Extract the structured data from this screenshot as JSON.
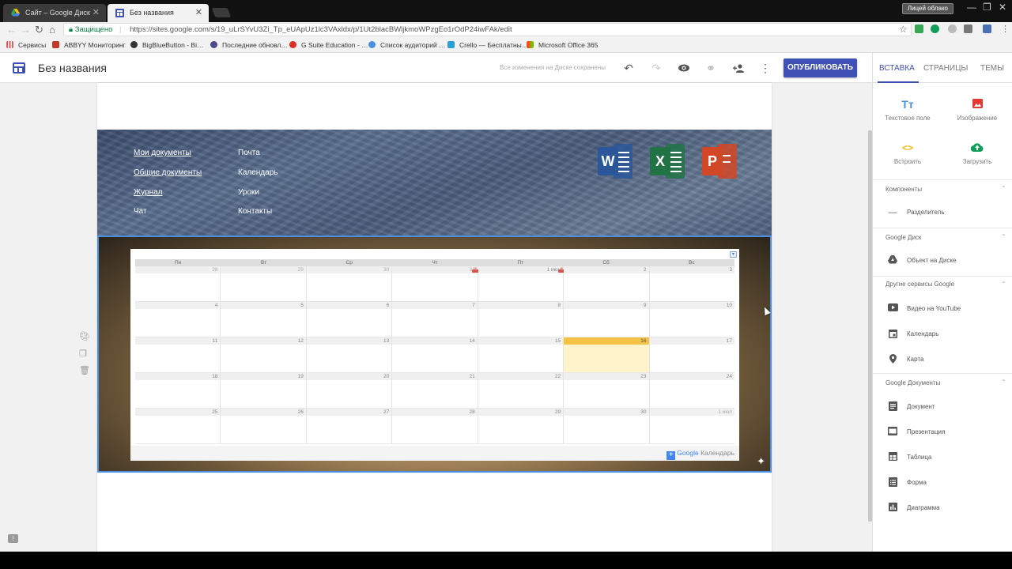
{
  "browser": {
    "tabs": [
      {
        "title": "Сайт – Google Диск",
        "active": false
      },
      {
        "title": "Без названия",
        "active": true
      }
    ],
    "profile": "Лицей облако",
    "secure_label": "Защищено",
    "url": "https://sites.google.com/s/19_uLrSYvU3Zi_Tp_eUApUz1lc3VAxldx/p/1Ut2blacBWljkmoWPzgEo1rOdP24iwFAk/edit",
    "bookmarks": [
      {
        "label": "Сервисы",
        "color": "#e06060"
      },
      {
        "label": "ABBYY Мониторинг",
        "color": "#c0392b"
      },
      {
        "label": "BigBlueButton - Bi…",
        "color": "#333333"
      },
      {
        "label": "Последние обновл…",
        "color": "#4a4a8a"
      },
      {
        "label": "G Suite Education - …",
        "color": "#d93025"
      },
      {
        "label": "Список аудиторий …",
        "color": "#4a90e2"
      },
      {
        "label": "Crello — Бесплатны…",
        "color": "#2a9fd6"
      },
      {
        "label": "Microsoft Office 365",
        "color": "#f25022"
      }
    ]
  },
  "editor": {
    "title": "Без названия",
    "saved_status": "Все изменения на Диске сохранены",
    "publish_label": "ОПУБЛИКОВАТЬ"
  },
  "header_nav": {
    "col1": [
      "Мои документы",
      "Общие документы",
      "Журнал",
      "Чат"
    ],
    "col2": [
      "Почта",
      "Календарь",
      "Уроки",
      "Контакты"
    ],
    "office_letters": [
      "W",
      "X",
      "P"
    ]
  },
  "calendar": {
    "weekdays": [
      "Пн",
      "Вт",
      "Ср",
      "Чт",
      "Пт",
      "Сб",
      "Вс"
    ],
    "weeks": [
      [
        "28",
        "29",
        "30",
        "31",
        "1 июн",
        "2",
        "3"
      ],
      [
        "4",
        "5",
        "6",
        "7",
        "8",
        "9",
        "10"
      ],
      [
        "11",
        "12",
        "13",
        "14",
        "15",
        "16",
        "17"
      ],
      [
        "18",
        "19",
        "20",
        "21",
        "22",
        "23",
        "24"
      ],
      [
        "25",
        "26",
        "27",
        "28",
        "29",
        "30",
        "1 июл"
      ]
    ],
    "today": "16",
    "brand_google": "Google",
    "brand_calendar": "Календарь"
  },
  "panel": {
    "tabs": [
      "ВСТАВКА",
      "СТРАНИЦЫ",
      "ТЕМЫ"
    ],
    "insert_items": [
      {
        "label": "Текстовое поле",
        "icon": "text-box-icon"
      },
      {
        "label": "Изображение",
        "icon": "image-icon"
      },
      {
        "label": "Встроить",
        "icon": "embed-icon"
      },
      {
        "label": "Загрузить",
        "icon": "upload-icon"
      }
    ],
    "sections": [
      {
        "title": "Компоненты",
        "items": [
          "Разделитель"
        ]
      },
      {
        "title": "Google Диск",
        "items": [
          "Объект на Диске"
        ]
      },
      {
        "title": "Другие сервисы Google",
        "items": [
          "Видео на YouTube",
          "Календарь",
          "Карта"
        ]
      },
      {
        "title": "Google Документы",
        "items": [
          "Документ",
          "Презентация",
          "Таблица",
          "Форма",
          "Диаграмма"
        ]
      }
    ]
  },
  "colors": {
    "accent": "#3f51b5",
    "today_header": "#f6c244",
    "word": "#2b579a",
    "excel": "#217346",
    "powerpoint": "#d24726"
  }
}
